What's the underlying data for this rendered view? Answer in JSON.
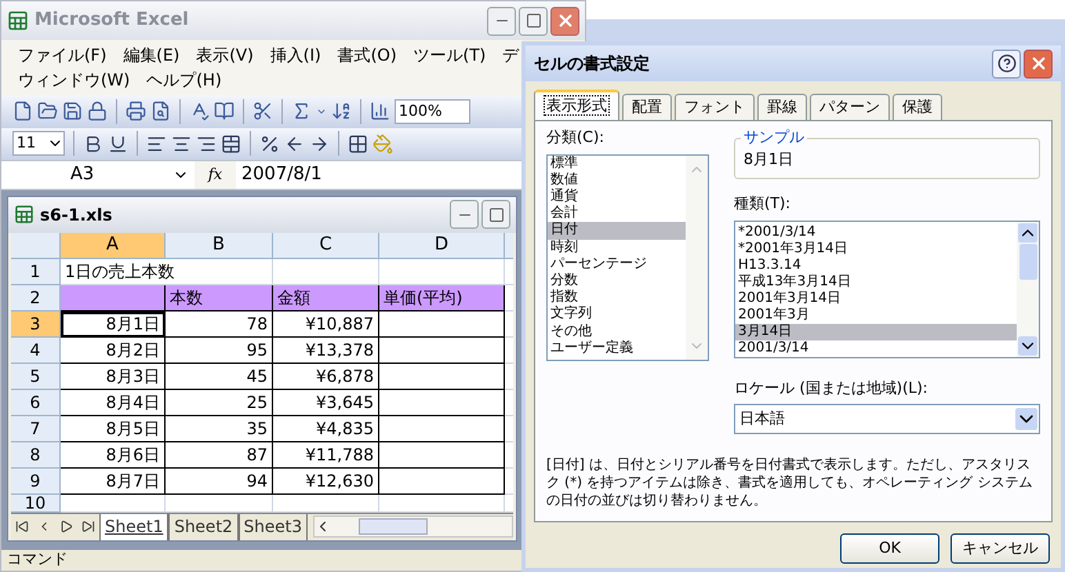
{
  "excel": {
    "title": "Microsoft Excel",
    "menu": [
      [
        "ファイル(F)",
        "編集(E)",
        "表示(V)",
        "挿入(I)",
        "書式(O)",
        "ツール(T)",
        "デ"
      ],
      [
        "ウィンドウ(W)",
        "ヘルプ(H)"
      ]
    ],
    "zoom": "100%",
    "font_size": "11",
    "name_box": "A3",
    "function_label": "fx",
    "formula": "2007/8/1"
  },
  "workbook": {
    "title": "s6-1.xls",
    "columns": [
      {
        "label": "A",
        "selected": true
      },
      {
        "label": "B",
        "selected": false
      },
      {
        "label": "C",
        "selected": false
      },
      {
        "label": "D",
        "selected": false
      }
    ],
    "rows": [
      {
        "header": "1",
        "kind": "title",
        "selected": false,
        "cells": [
          "1日の売上本数"
        ]
      },
      {
        "header": "2",
        "kind": "header",
        "selected": false,
        "cells": [
          null,
          "本数",
          "金額",
          "単価(平均)"
        ]
      },
      {
        "header": "3",
        "kind": "data",
        "selected": true,
        "cells": [
          "8月1日",
          "78",
          "¥10,887",
          null
        ]
      },
      {
        "header": "4",
        "kind": "data",
        "selected": false,
        "cells": [
          "8月2日",
          "95",
          "¥13,378",
          null
        ]
      },
      {
        "header": "5",
        "kind": "data",
        "selected": false,
        "cells": [
          "8月3日",
          "45",
          "¥6,878",
          null
        ]
      },
      {
        "header": "6",
        "kind": "data",
        "selected": false,
        "cells": [
          "8月4日",
          "25",
          "¥3,645",
          null
        ]
      },
      {
        "header": "7",
        "kind": "data",
        "selected": false,
        "cells": [
          "8月5日",
          "35",
          "¥4,835",
          null
        ]
      },
      {
        "header": "8",
        "kind": "data",
        "selected": false,
        "cells": [
          "8月6日",
          "87",
          "¥11,788",
          null
        ]
      },
      {
        "header": "9",
        "kind": "data",
        "selected": false,
        "cells": [
          "8月7日",
          "94",
          "¥12,630",
          null
        ]
      },
      {
        "header": "10",
        "kind": "empty",
        "selected": false,
        "cells": []
      }
    ],
    "sheet_tabs": [
      {
        "label": "Sheet1",
        "selected": true
      },
      {
        "label": "Sheet2",
        "selected": false
      },
      {
        "label": "Sheet3",
        "selected": false
      }
    ]
  },
  "status_bar": "コマンド",
  "dialog": {
    "title": "セルの書式設定",
    "tabs": [
      {
        "label": "表示形式",
        "selected": true
      },
      {
        "label": "配置",
        "selected": false
      },
      {
        "label": "フォント",
        "selected": false
      },
      {
        "label": "罫線",
        "selected": false
      },
      {
        "label": "パターン",
        "selected": false
      },
      {
        "label": "保護",
        "selected": false
      }
    ],
    "category_label": "分類(C):",
    "categories": [
      {
        "label": "標準",
        "selected": false
      },
      {
        "label": "数値",
        "selected": false
      },
      {
        "label": "通貨",
        "selected": false
      },
      {
        "label": "会計",
        "selected": false
      },
      {
        "label": "日付",
        "selected": true
      },
      {
        "label": "時刻",
        "selected": false
      },
      {
        "label": "パーセンテージ",
        "selected": false
      },
      {
        "label": "分数",
        "selected": false
      },
      {
        "label": "指数",
        "selected": false
      },
      {
        "label": "文字列",
        "selected": false
      },
      {
        "label": "その他",
        "selected": false
      },
      {
        "label": "ユーザー定義",
        "selected": false
      }
    ],
    "sample_label": "サンプル",
    "sample": "8月1日",
    "type_label": "種類(T):",
    "types": [
      {
        "label": "*2001/3/14",
        "selected": false
      },
      {
        "label": "*2001年3月14日",
        "selected": false
      },
      {
        "label": "H13.3.14",
        "selected": false
      },
      {
        "label": "平成13年3月14日",
        "selected": false
      },
      {
        "label": "2001年3月14日",
        "selected": false
      },
      {
        "label": "2001年3月",
        "selected": false
      },
      {
        "label": "3月14日",
        "selected": true
      },
      {
        "label": "2001/3/14",
        "selected": false
      }
    ],
    "locale_label": "ロケール (国または地域)(L):",
    "locale": "日本語",
    "description": "[日付] は、日付とシリアル番号を日付書式で表示します。ただし、アスタリスク (*) を持つアイテムは除き、書式を適用しても、オペレーティング システムの日付の並びは切り替わりません。",
    "buttons": [
      "OK",
      "キャンセル"
    ]
  }
}
